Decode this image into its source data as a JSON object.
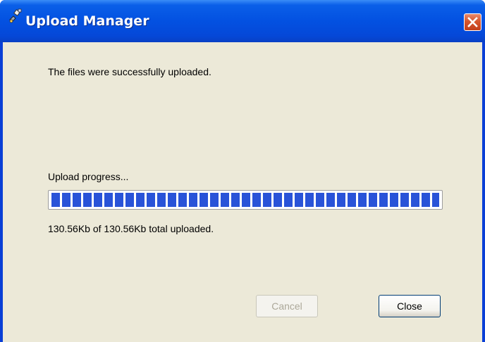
{
  "window": {
    "title": "Upload Manager",
    "icon": "upload-satellite-icon",
    "close_icon": "close-icon"
  },
  "dialog": {
    "message": "The files were successfully uploaded.",
    "progress_label": "Upload progress...",
    "progress_fraction": 1.0,
    "progress_status": "130.56Kb of 130.56Kb total uploaded."
  },
  "buttons": {
    "cancel_label": "Cancel",
    "cancel_enabled": false,
    "close_label": "Close"
  },
  "colors": {
    "titlebar": "#0351e1",
    "client_bg": "#ece9d8",
    "progress_block": "#2953d8",
    "close_button": "#d7562d"
  }
}
